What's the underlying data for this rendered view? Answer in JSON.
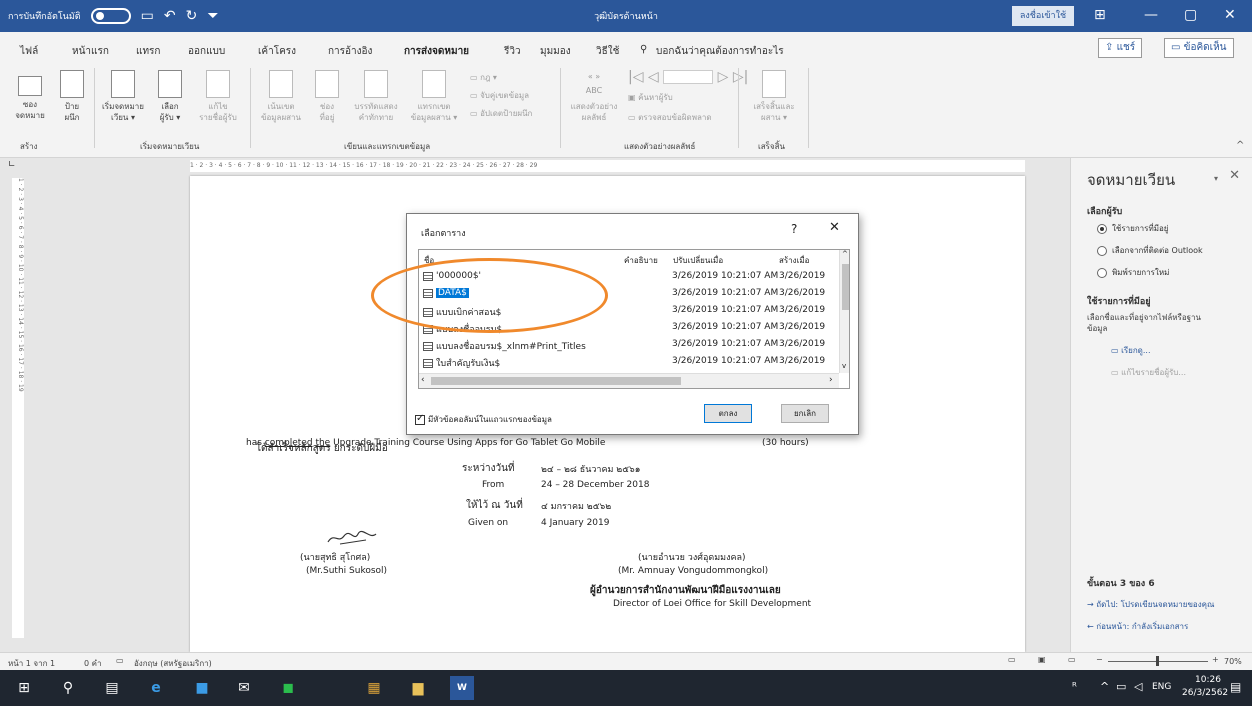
{
  "titlebar": {
    "autosave": "การบันทึกอัตโนมัติ",
    "title": "วุฒิบัตรด้านหน้า",
    "signin": "ลงชื่อเข้าใช้"
  },
  "menu": {
    "items": [
      "ไฟล์",
      "หน้าแรก",
      "แทรก",
      "ออกแบบ",
      "เค้าโครง",
      "การอ้างอิง",
      "การส่งจดหมาย",
      "รีวิว",
      "มุมมอง",
      "วิธีใช้"
    ],
    "search": "บอกฉันว่าคุณต้องการทำอะไร",
    "share": "แชร์",
    "comment": "ข้อคิดเห็น"
  },
  "ribbon": {
    "envelopes": "ซอง",
    "labels": "ป้าย",
    "envelopes2": "จดหมาย",
    "labels2": "ผนึก",
    "start": "เริ่มจดหมาย",
    "start2": "เวียน",
    "select": "เลือก",
    "select2": "ผู้รับ",
    "edit": "แก้ไข",
    "edit2": "รายชื่อผู้รับ",
    "highlight": "เน้นเขต",
    "highlight2": "ข้อมูลผสาน",
    "addr": "ช่อง",
    "addr2": "ที่อยู่",
    "greet": "บรรทัดแสดง",
    "greet2": "คำทักทาย",
    "insert": "แทรกเขต",
    "insert2": "ข้อมูลผสาน",
    "rules": "กฎ",
    "match": "จับคู่เขตข้อมูล",
    "update": "อัปเดตป้ายผนึก",
    "preview": "แสดงตัวอย่าง",
    "preview2": "ผลลัพธ์",
    "find": "ค้นหาผู้รับ",
    "check": "ตรวจสอบข้อผิดพลาด",
    "finish": "เสร็จสิ้นและ",
    "finish2": "ผสาน",
    "g_create": "สร้าง",
    "g_start": "เริ่มจดหมายเวียน",
    "g_write": "เขียนและแทรกเขตข้อมูล",
    "g_preview": "แสดงตัวอย่างผลลัพธ์",
    "g_finish": "เสร็จสิ้น"
  },
  "ruler": "1 · 2 · 3 · 4 · 5 · 6 · 7 · 8 · 9 · 10 · 11 · 12 · 13 · 14 · 15 · 16 · 17 · 18 · 19 · 20 · 21 · 22 · 23 · 24 · 25 · 26 · 27 · 28 · 29",
  "vruler": "1 · 2 · 3 · 4 · 5 · 6 · 7 · 8 · 9 · 10 · 11 · 12 · 13 · 14 · 15 · 16 · 17 · 18 · 19",
  "doc": {
    "line1": "ได้สำเร็จหลักสูตร   ยกระดับฝีมือ",
    "has": "has",
    "completed": "completed",
    "the": "the",
    "line2": "Upgrade Training     Course Using Apps for Go Tablet Go Mobile",
    "hours": "(30  hours)",
    "between": "ระหว่างวันที่",
    "date_th": "๒๔ – ๒๘ ธันวาคม ๒๕๖๑",
    "from": "From",
    "date_en": "24 – 28  December  2018",
    "given_th": "ให้ไว้ ณ วันที่",
    "gdate_th": "๔ มกราคม ๒๕๖๒",
    "given_en": "Given on",
    "gdate_en": "4  January  2019",
    "sig1_th": "(นายสุทธิ  สุโกศล)",
    "sig1_en": "(Mr.Suthi  Sukosol)",
    "sig2_th": "(นายอำนวย วงศ์อุดมมงคล)",
    "sig2_en": "(Mr. Amnuay  Vongudommongkol)",
    "director_th": "ผู้อำนวยการสำนักงานพัฒนาฝีมือแรงงานเลย",
    "director_en": "Director of Loei Office for Skill Development"
  },
  "pane": {
    "title": "จดหมายเวียน",
    "h1": "เลือกผู้รับ",
    "opt1": "ใช้รายการที่มีอยู่",
    "opt2": "เลือกจากที่ติดต่อ Outlook",
    "opt3": "พิมพ์รายการใหม่",
    "h2": "ใช้รายการที่มีอยู่",
    "desc": "เลือกชื่อและที่อยู่จากไฟล์หรือฐานข้อมูล",
    "browse": "เรียกดู...",
    "editlist": "แก้ไขรายชื่อผู้รับ...",
    "step": "ขั้นตอน 3 ของ 6",
    "next": "ถัดไป: โปรดเขียนจดหมายของคุณ",
    "prev": "ก่อนหน้า: กำลังเริ่มเอกสาร"
  },
  "dialog": {
    "title": "เลือกตาราง",
    "help": "?",
    "close": "✕",
    "col_name": "ชื่อ",
    "col_desc": "คำอธิบาย",
    "col_mod": "ปรับเปลี่ยนเมื่อ",
    "col_created": "สร้างเมื่อ",
    "rows": [
      {
        "name": "'000000$'",
        "modified": "3/26/2019 10:21:07 AM",
        "created": "3/26/2019"
      },
      {
        "name": "DATA$",
        "modified": "3/26/2019 10:21:07 AM",
        "created": "3/26/2019"
      },
      {
        "name": "แบบเบิกค่าสอน$",
        "modified": "3/26/2019 10:21:07 AM",
        "created": "3/26/2019"
      },
      {
        "name": "แบบลงชื่ออบรม$",
        "modified": "3/26/2019 10:21:07 AM",
        "created": "3/26/2019"
      },
      {
        "name": "แบบลงชื่ออบรม$_xlnm#Print_Titles",
        "modified": "3/26/2019 10:21:07 AM",
        "created": "3/26/2019"
      },
      {
        "name": "ใบสำคัญรับเงิน$",
        "modified": "3/26/2019 10:21:07 AM",
        "created": "3/26/2019"
      }
    ],
    "checkbox": "มีหัวข้อคอลัมน์ในแถวแรกของข้อมูล",
    "ok": "ตกลง",
    "cancel": "ยกเลิก"
  },
  "status": {
    "page": "หน้า 1 จาก 1",
    "words": "0 คำ",
    "lang": "อังกฤษ (สหรัฐอเมริกา)",
    "zoom": "70%"
  },
  "taskbar": {
    "lang": "ENG",
    "time": "10:26",
    "date": "26/3/2562"
  },
  "colors": {
    "word_blue": "#2b579a",
    "selection": "#0078d7",
    "highlight_ellipse": "#f0892c"
  }
}
